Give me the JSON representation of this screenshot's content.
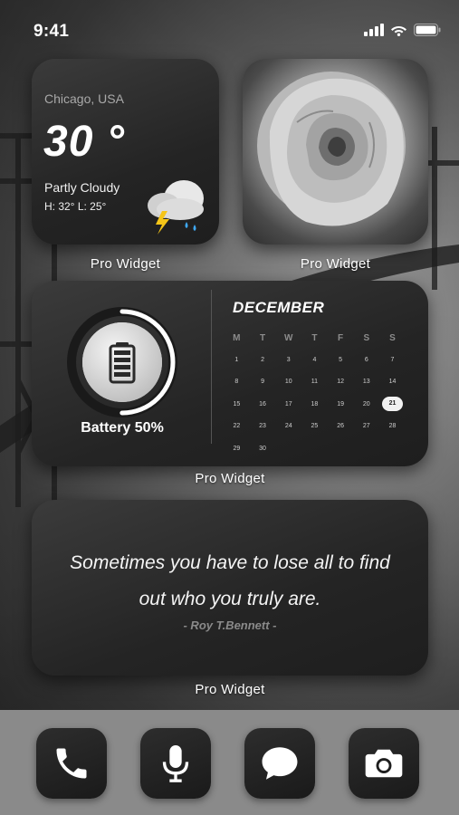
{
  "status": {
    "time": "9:41",
    "icons": [
      "signal-icon",
      "wifi-icon",
      "battery-icon"
    ]
  },
  "weather_widget": {
    "city": "Chicago, USA",
    "temperature": "30 °",
    "condition": "Partly Cloudy",
    "high_low": "H: 32°  L: 25°",
    "icon": "cloud-storm-icon",
    "caption": "Pro Widget"
  },
  "photo_widget": {
    "icon": "rose-photo",
    "caption": "Pro Widget"
  },
  "battery_calendar_widget": {
    "battery_label": "Battery 50%",
    "battery_level": 0.5,
    "month": "DECEMBER",
    "weekdays": [
      "M",
      "T",
      "W",
      "T",
      "F",
      "S",
      "S"
    ],
    "weeks": [
      [
        "1",
        "2",
        "3",
        "4",
        "5",
        "6",
        "7"
      ],
      [
        "8",
        "9",
        "10",
        "11",
        "12",
        "13",
        "14"
      ],
      [
        "15",
        "16",
        "17",
        "18",
        "19",
        "20",
        "21"
      ],
      [
        "22",
        "23",
        "24",
        "25",
        "26",
        "27",
        "28"
      ],
      [
        "29",
        "30",
        "",
        "",
        "",
        "",
        ""
      ]
    ],
    "today": "21",
    "caption": "Pro Widget"
  },
  "quote_widget": {
    "line1": "Sometimes you have to lose all to find",
    "line2": "out who you truly are.",
    "author": "- Roy T.Bennett -",
    "caption": "Pro Widget"
  },
  "dock": {
    "apps": [
      {
        "icon": "phone-icon"
      },
      {
        "icon": "microphone-icon"
      },
      {
        "icon": "message-icon"
      },
      {
        "icon": "camera-icon"
      }
    ]
  },
  "colors": {
    "widget_bg": "#2a2a2a",
    "dock_bg": "#8a8a8a",
    "ring": "#ffffff"
  }
}
